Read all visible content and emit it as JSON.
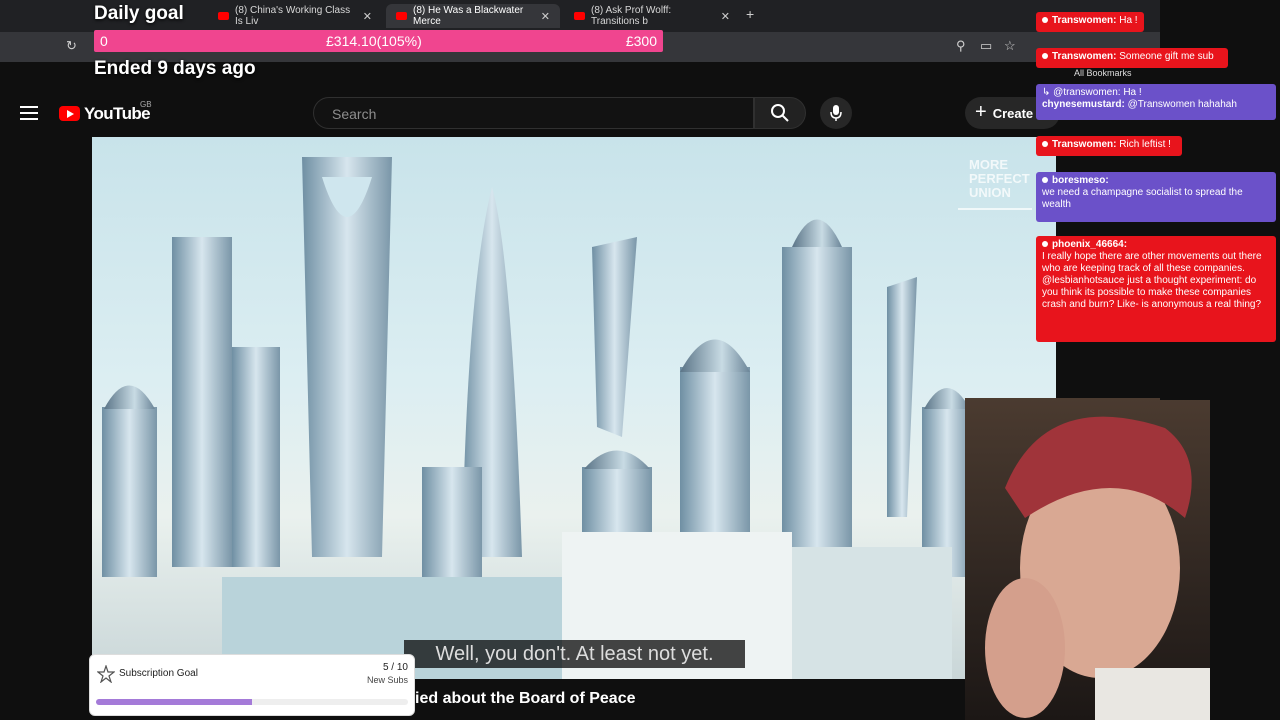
{
  "browser": {
    "tabs": [
      {
        "label": ""
      },
      {
        "label": "(8) China's Working Class Is Liv"
      },
      {
        "label": "(8) He Was a Blackwater Merce"
      },
      {
        "label": "(8) Ask Prof Wolff: Transitions b"
      }
    ],
    "new_tab": "+",
    "close_glyph": "✕",
    "bookmarks_label": "All Bookmarks"
  },
  "daily_goal": {
    "title": "Daily goal",
    "start": "0",
    "current": "£314.10(105%)",
    "target": "£300",
    "status": "Ended 9 days ago",
    "bar_color": "#f0458f"
  },
  "youtube": {
    "logo_text": "YouTube",
    "region": "GB",
    "search_placeholder": "Search",
    "create_label": "Create",
    "icons": [
      "menu-icon",
      "youtube-logo-icon",
      "search-icon",
      "mic-icon",
      "plus-icon"
    ]
  },
  "video": {
    "watermark": [
      "MORE",
      "PERFECT",
      "UNION"
    ],
    "caption": "Well, you don't. At least not yet.",
    "title": "ied about the Board of Peace"
  },
  "sub_goal": {
    "label": "Subscription Goal",
    "count": "5 / 10",
    "unit": "New Subs",
    "progress": 0.5,
    "fill_color": "#a47ad8"
  },
  "chat": [
    {
      "user": "Transwomen:",
      "text": "Ha !",
      "color": "#e8141c"
    },
    {
      "user": "Transwomen:",
      "text": "Someone gift me sub",
      "color": "#e8141c"
    },
    {
      "reply": "↳ @transwomen: Ha !",
      "user": "chynesemustard:",
      "text": "@Transwomen hahahah",
      "color": "#6b51c9"
    },
    {
      "user": "Transwomen:",
      "text": "Rich leftist !",
      "color": "#e8141c"
    },
    {
      "user": "boresmeso:",
      "text": "we need a champagne socialist to spread the wealth",
      "color": "#6b51c9"
    },
    {
      "user": "phoenix_46664:",
      "text": "I really hope there are other movements out there who are keeping track of all these companies. @lesbianhotsauce just a thought experiment: do you think its possible to make these companies crash and burn? Like- is anonymous a real thing?",
      "color": "#e8141c"
    }
  ]
}
